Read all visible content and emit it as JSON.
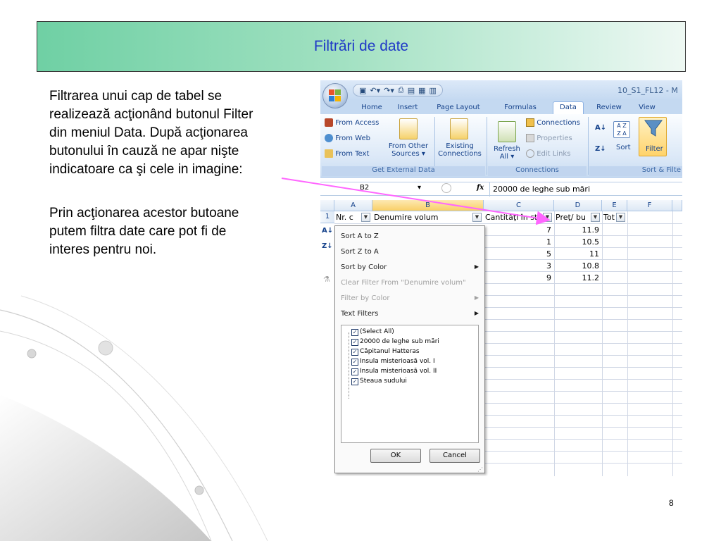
{
  "slide": {
    "title": "Filtrări de date",
    "paragraph1_lines": [
      "Filtrarea unui cap de tabel se",
      "realizează acţionând butonul Filter",
      "din meniul Data. După acţionarea",
      "butonului în cauză ne apar nişte",
      "indicatoare ca şi cele in imagine:"
    ],
    "paragraph2_lines": [
      "Prin acţionarea acestor butoane",
      "putem filtra date care pot fi de",
      "interes pentru noi."
    ],
    "page_number": "8",
    "colors": {
      "title": "#1f39c7",
      "arrow": "#ff66ff",
      "band_start": "#6fd0a4",
      "band_end": "#eef8f3"
    }
  },
  "excel": {
    "window_title": "10_S1_FL12 - M",
    "tabs": [
      "Home",
      "Insert",
      "Page Layout",
      "Formulas",
      "Data",
      "Review",
      "View"
    ],
    "active_tab": "Data",
    "ribbon": {
      "get_external_data": {
        "from_access": "From Access",
        "from_web": "From Web",
        "from_text": "From Text",
        "from_other_sources_1": "From Other",
        "from_other_sources_2": "Sources ▾",
        "existing_1": "Existing",
        "existing_2": "Connections",
        "label": "Get External Data"
      },
      "connections": {
        "refresh_1": "Refresh",
        "refresh_2": "All ▾",
        "connections": "Connections",
        "properties": "Properties",
        "edit_links": "Edit Links",
        "label": "Connections"
      },
      "sort_filter": {
        "sort": "Sort",
        "filter": "Filter",
        "label": "Sort & Filte"
      }
    },
    "name_box": "B2",
    "fx_symbol": "fx",
    "formula": "20000 de leghe sub mări",
    "column_headers": [
      "A",
      "B",
      "C",
      "D",
      "E",
      "F"
    ],
    "header_row": {
      "row_number": "1",
      "a": "Nr. c",
      "b": "Denumire volum",
      "c": "Cantităţi în st",
      "d": "Preţ/ bu",
      "e": "Tot"
    },
    "rows": [
      {
        "c": "7",
        "d": "11.9"
      },
      {
        "c": "1",
        "d": "10.5"
      },
      {
        "c": "5",
        "d": "11"
      },
      {
        "c": "3",
        "d": "10.8"
      },
      {
        "c": "9",
        "d": "11.2"
      }
    ],
    "filter_menu": {
      "sort_az": "Sort A to Z",
      "sort_za": "Sort Z to A",
      "sort_by_color": "Sort by Color",
      "clear_filter": "Clear Filter From \"Denumire volum\"",
      "filter_by_color": "Filter by Color",
      "text_filters": "Text Filters",
      "list_items": [
        "(Select All)",
        "20000 de leghe sub mări",
        "Căpitanul Hatteras",
        "Insula misterioasă vol. I",
        "Insula misterioasă vol. II",
        "Steaua sudului"
      ],
      "ok": "OK",
      "cancel": "Cancel"
    }
  }
}
